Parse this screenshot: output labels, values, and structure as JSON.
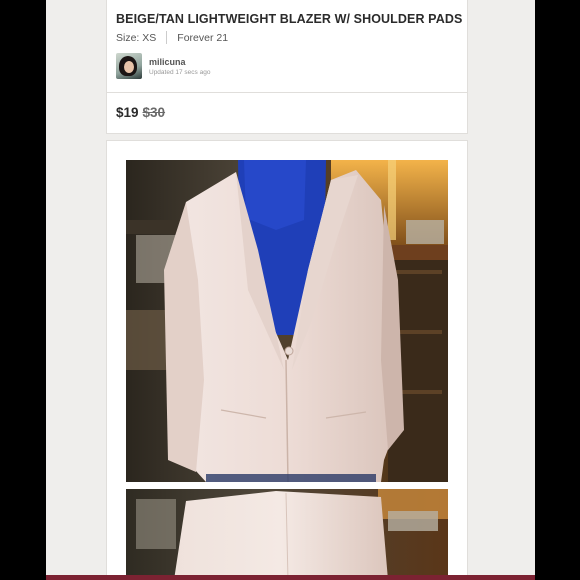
{
  "listing": {
    "title": "BEIGE/TAN LIGHTWEIGHT BLAZER W/ SHOULDER PADS",
    "size": "Size: XS",
    "brand": "Forever 21",
    "seller": {
      "username": "milicuna",
      "updated": "Updated 17 secs ago"
    },
    "price": {
      "current": "$19",
      "original": "$30"
    }
  },
  "photos": [
    {
      "subject": "blazer-front-photo"
    },
    {
      "subject": "blazer-back-photo"
    }
  ],
  "colors": {
    "background": "#efeeec",
    "card": "#ffffff",
    "text": "#2b2b2b",
    "bottom_bar": "#7c2232"
  }
}
